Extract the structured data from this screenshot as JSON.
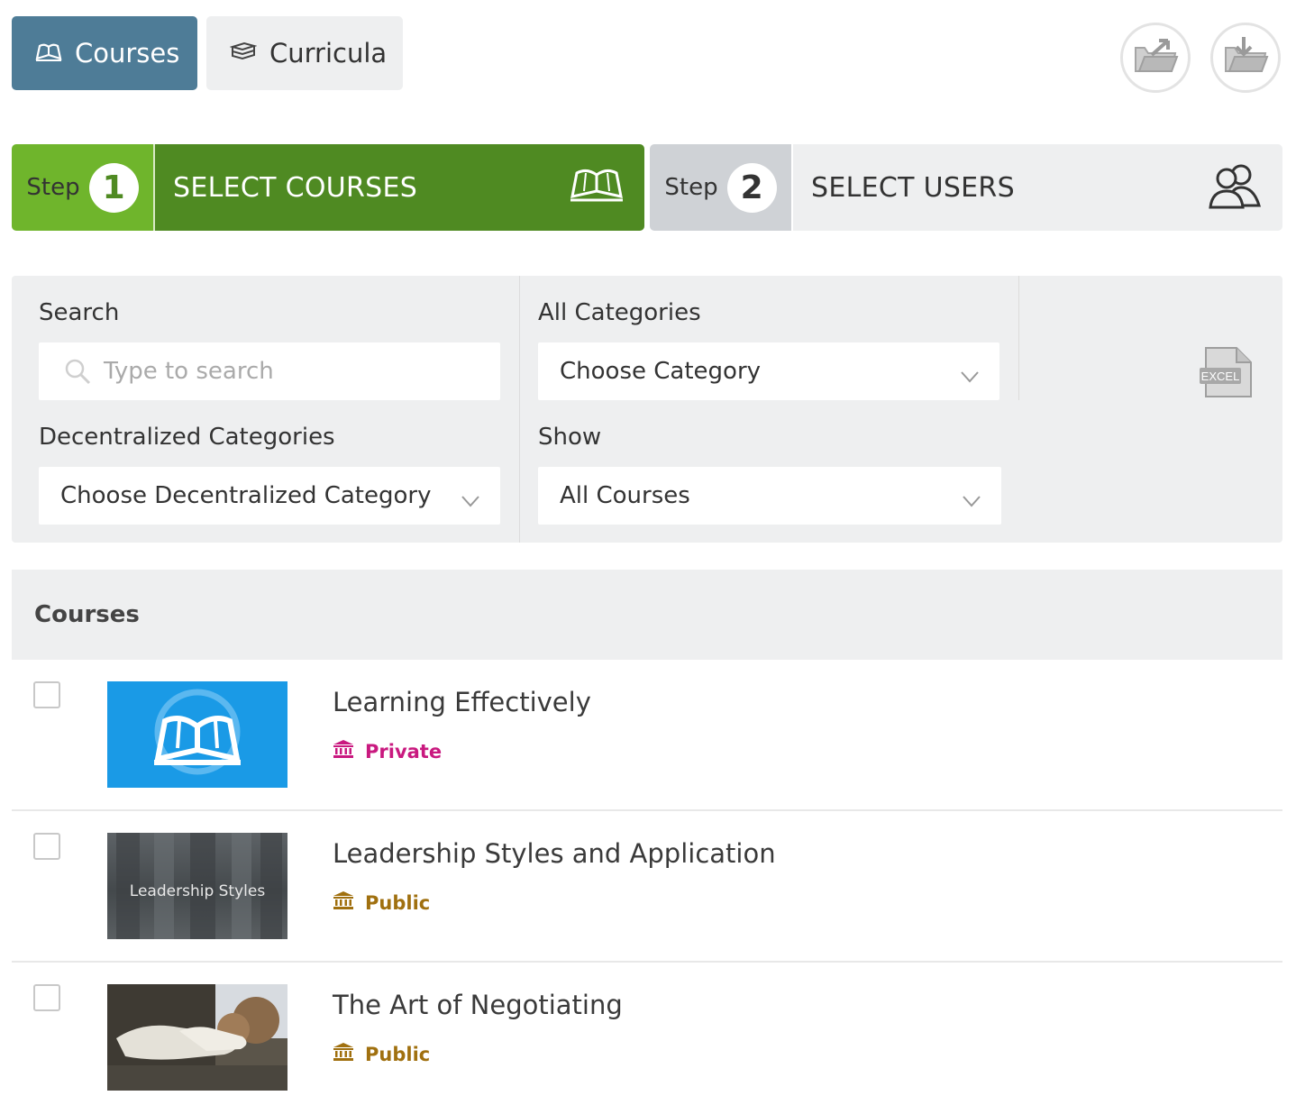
{
  "tabs": [
    {
      "label": "Courses",
      "icon": "open-book-icon",
      "active": true
    },
    {
      "label": "Curricula",
      "icon": "stacked-books-icon",
      "active": false
    }
  ],
  "toolbar": {
    "import_icon": "folder-upload-icon",
    "export_icon": "folder-download-icon"
  },
  "wizard": {
    "step1": {
      "prefix": "Step",
      "number": "1",
      "title": "SELECT COURSES",
      "icon": "open-book-icon",
      "color_light": "#6fb52c",
      "color_dark": "#4f8a22"
    },
    "step2": {
      "prefix": "Step",
      "number": "2",
      "title": "SELECT USERS",
      "icon": "users-icon",
      "color_light": "#cfd2d6",
      "color_dark": "#eeeff0"
    }
  },
  "filters": {
    "search_label": "Search",
    "search_placeholder": "Type to search",
    "category_label": "All Categories",
    "category_value": "Choose Category",
    "decentralized_label": "Decentralized Categories",
    "decentralized_value": "Choose Decentralized Category",
    "show_label": "Show",
    "show_value": "All Courses",
    "excel_label": "EXCEL"
  },
  "courses": {
    "header": "Courses",
    "items": [
      {
        "title": "Learning Effectively",
        "visibility": "Private",
        "visibility_color": "#c9197f",
        "thumbnail": "open-book-logo"
      },
      {
        "title": "Leadership Styles and Application",
        "visibility": "Public",
        "visibility_color": "#a0700f",
        "thumbnail": "Leadership Styles"
      },
      {
        "title": "The Art of Negotiating",
        "visibility": "Public",
        "visibility_color": "#a0700f",
        "thumbnail": "handshake-photo"
      }
    ]
  }
}
